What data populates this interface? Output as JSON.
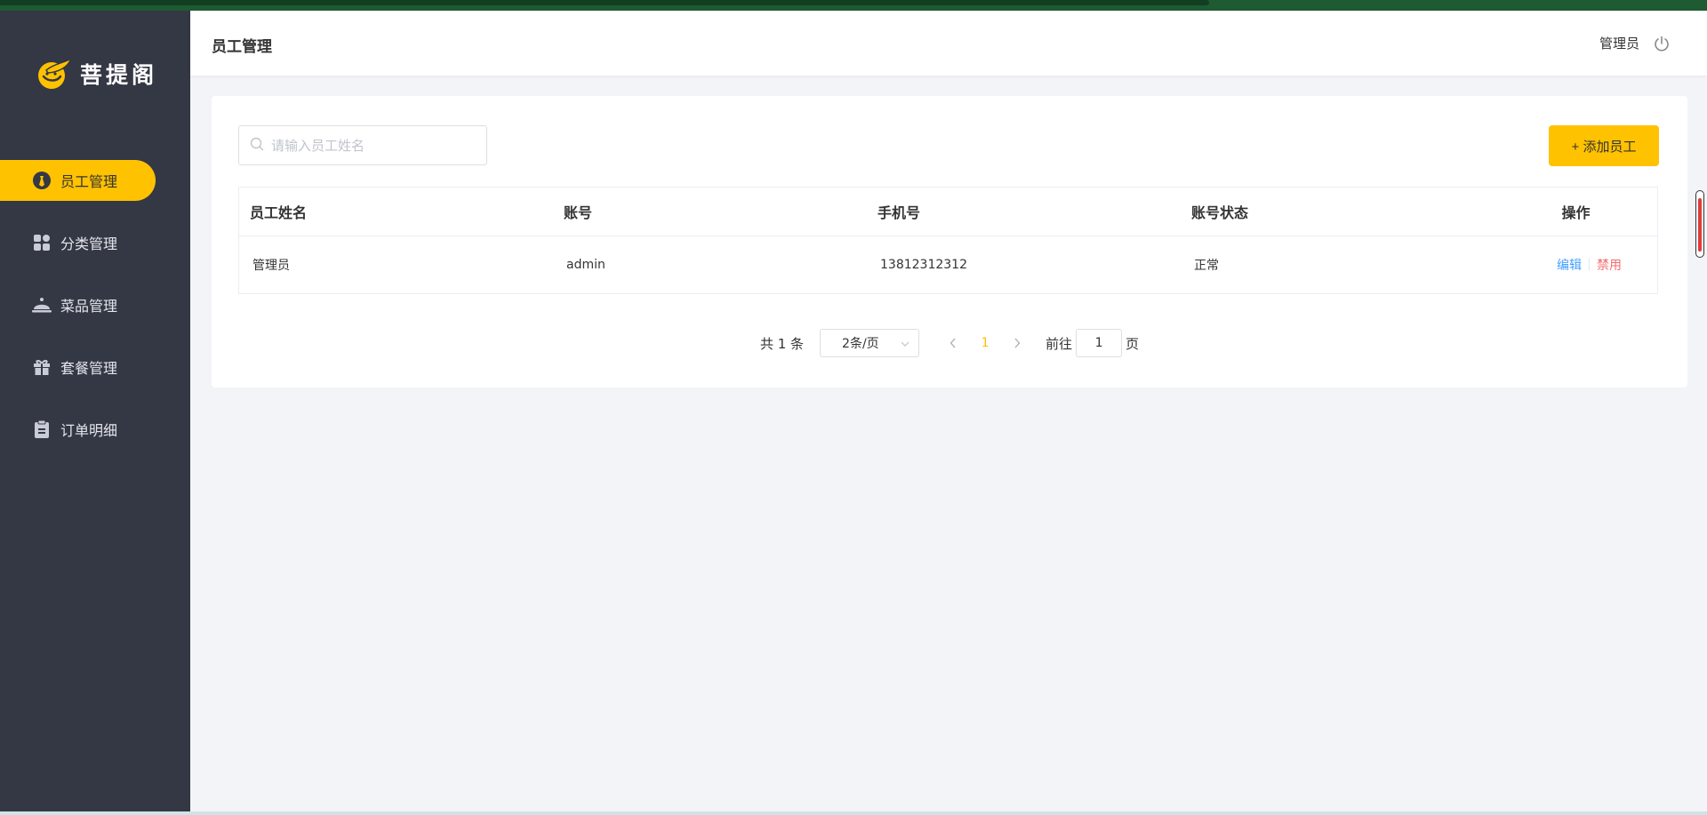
{
  "brand": {
    "name": "菩提阁",
    "accent": "#ffc200",
    "sidebar_bg": "#343744"
  },
  "sidebar": {
    "items": [
      {
        "label": "员工管理",
        "icon": "employee-icon",
        "active": true
      },
      {
        "label": "分类管理",
        "icon": "category-grid-icon",
        "active": false
      },
      {
        "label": "菜品管理",
        "icon": "dish-cloche-icon",
        "active": false
      },
      {
        "label": "套餐管理",
        "icon": "gift-icon",
        "active": false
      },
      {
        "label": "订单明细",
        "icon": "clipboard-icon",
        "active": false
      }
    ]
  },
  "header": {
    "title": "员工管理",
    "user": "管理员",
    "logout_icon": "power-icon"
  },
  "toolbar": {
    "search_placeholder": "请输入员工姓名",
    "search_value": "",
    "add_label": "+ 添加员工"
  },
  "table": {
    "columns": [
      "员工姓名",
      "账号",
      "手机号",
      "账号状态",
      "操作"
    ],
    "rows": [
      {
        "name": "管理员",
        "account": "admin",
        "phone": "13812312312",
        "status": "正常",
        "edit": "编辑",
        "disable": "禁用"
      }
    ]
  },
  "pagination": {
    "total_label": "共 1 条",
    "page_size": "2条/页",
    "current_page": "1",
    "goto_prefix": "前往",
    "goto_value": "1",
    "goto_suffix": "页"
  }
}
